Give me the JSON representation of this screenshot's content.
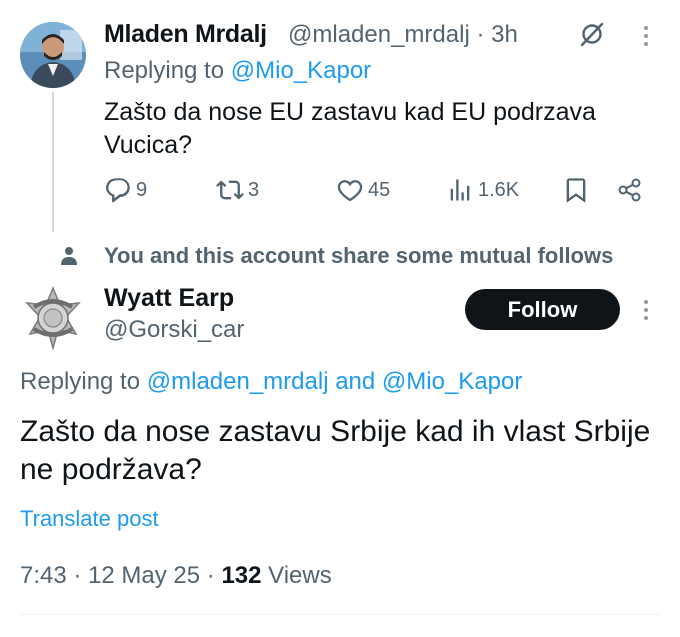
{
  "tweet1": {
    "author_name": "Mladen Mrdalj",
    "handle_time": "@mladen_mrdalj · 3h",
    "replying_prefix": "Replying to ",
    "replying_to": "@Mio_Kapor",
    "text": "Zašto da nose EU zastavu kad EU podrzava Vucica?",
    "replies": "9",
    "reposts": "3",
    "likes": "45",
    "views": "1.6K",
    "icons": [
      "grok-icon",
      "more-icon",
      "reply-icon",
      "repost-icon",
      "like-icon",
      "views-icon",
      "bookmark-icon",
      "share-icon"
    ]
  },
  "mutual_note": "You and this account share some mutual follows",
  "tweet2": {
    "author_name": "Wyatt Earp",
    "handle": "@Gorski_car",
    "follow_label": "Follow",
    "replying_prefix": "Replying to ",
    "replying_to_1": "@mladen_mrdalj",
    "replying_and": " and ",
    "replying_to_2": "@Mio_Kapor",
    "text": "Zašto da nose zastavu Srbije kad ih vlast Srbije ne podržava?",
    "translate": "Translate post",
    "time_date": "7:43 · 12 May 25 · ",
    "view_count": "132",
    "views_label": " Views"
  },
  "colors": {
    "accent": "#1d9bf0",
    "text": "#0f1419",
    "muted": "#536471",
    "button_bg": "#0f1419"
  }
}
